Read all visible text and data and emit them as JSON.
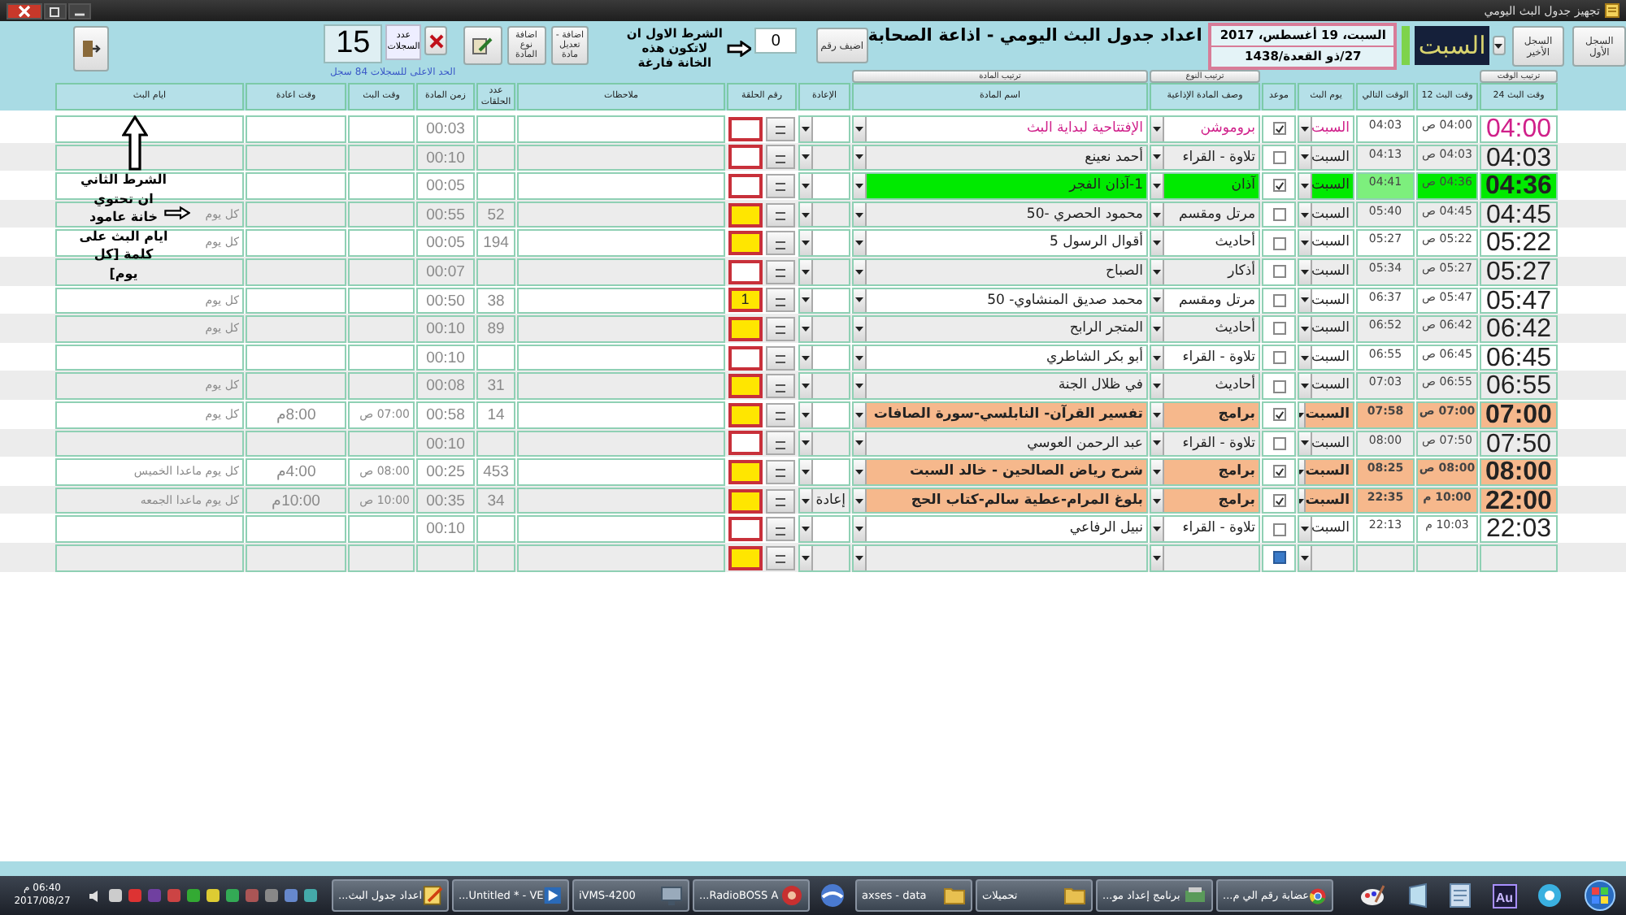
{
  "window": {
    "title": "تجهيز جدول البث اليومي"
  },
  "nav_buttons": [
    "السجل الأول",
    "السجل الأخير"
  ],
  "day_name": "السبت",
  "date": {
    "gregorian": "السبت، 19 أغسطس، 2017",
    "hijri": "27/ذو القعدة/1438"
  },
  "title": "اعداد جدول البث اليومي - اذاعة الصحابة",
  "add_number_button": "اضيف رقم",
  "number_field": {
    "value": "0"
  },
  "note_1": "الشرط الاول ان لاتكون هذه الخانة فارغة",
  "tool_buttons": [
    "اضافة - تعديل مادة",
    "اضافة نوع المادة"
  ],
  "record_count": {
    "label": "عدد السجلات",
    "value": "15",
    "limit": "الحد الاعلى للسجلات 84 سجل"
  },
  "sort_buttons": {
    "time": "ترتيب الوقت",
    "type": "ترتيب النوع",
    "name": "ترتيب المادة"
  },
  "table": {
    "columns": [
      "وقت البث 24",
      "وقت البث 12",
      "الوقت التالي",
      "يوم البث",
      "موعد",
      "وصف المادة الإذاعية",
      "اسم المادة",
      "الإعادة",
      "رقم الحلقة",
      "ملاحظات",
      "عدد الحلقات",
      "زمن المادة",
      "وقت البث",
      "وقت اعادة",
      "ايام البث"
    ],
    "rows": [
      {
        "t24": "04:00",
        "t12": "04:00 ص",
        "next": "04:03",
        "day": "السبت",
        "appointment": true,
        "type": "بروموشن",
        "name": "الإفتتاحية لبداية البث",
        "episode_filled": false,
        "duration": "00:03",
        "kind": "promo"
      },
      {
        "t24": "04:03",
        "t12": "04:03 ص",
        "next": "04:13",
        "day": "السبت",
        "appointment": false,
        "type": "تلاوة - القراء",
        "name": "أحمد نعينع",
        "episode_filled": false,
        "duration": "00:10",
        "kind": "plain"
      },
      {
        "t24": "04:36",
        "t12": "04:36 ص",
        "next": "04:41",
        "day": "السبت",
        "appointment": true,
        "type": "آذان",
        "name": "1-آذان الفجر",
        "episode_filled": false,
        "duration": "00:05",
        "kind": "adhan"
      },
      {
        "t24": "04:45",
        "t12": "04:45 ص",
        "next": "05:40",
        "day": "السبت",
        "appointment": false,
        "type": "مرتل ومقسم",
        "name": "محمود الحصري -50",
        "episode_filled": true,
        "count": "52",
        "duration": "00:55",
        "days": "كل يوم",
        "kind": "plain"
      },
      {
        "t24": "05:22",
        "t12": "05:22 ص",
        "next": "05:27",
        "day": "السبت",
        "appointment": false,
        "type": "أحاديث",
        "name": "أقوال الرسول 5",
        "episode_filled": true,
        "count": "194",
        "duration": "00:05",
        "days": "كل يوم",
        "kind": "plain"
      },
      {
        "t24": "05:27",
        "t12": "05:27 ص",
        "next": "05:34",
        "day": "السبت",
        "appointment": false,
        "type": "أذكار",
        "name": "الصباح",
        "episode_filled": false,
        "duration": "00:07",
        "kind": "plain"
      },
      {
        "t24": "05:47",
        "t12": "05:47 ص",
        "next": "06:37",
        "day": "السبت",
        "appointment": false,
        "type": "مرتل ومقسم",
        "name": "محمد صديق المنشاوي- 50",
        "episode": "1",
        "episode_filled": true,
        "count": "38",
        "duration": "00:50",
        "days": "كل يوم",
        "kind": "plain"
      },
      {
        "t24": "06:42",
        "t12": "06:42 ص",
        "next": "06:52",
        "day": "السبت",
        "appointment": false,
        "type": "أحاديث",
        "name": "المتجر الرابح",
        "episode_filled": true,
        "count": "89",
        "duration": "00:10",
        "days": "كل يوم",
        "kind": "plain"
      },
      {
        "t24": "06:45",
        "t12": "06:45 ص",
        "next": "06:55",
        "day": "السبت",
        "appointment": false,
        "type": "تلاوة - القراء",
        "name": "أبو بكر الشاطري",
        "episode_filled": false,
        "duration": "00:10",
        "kind": "plain"
      },
      {
        "t24": "06:55",
        "t12": "06:55 ص",
        "next": "07:03",
        "day": "السبت",
        "appointment": false,
        "type": "أحاديث",
        "name": "في ظلال الجنة",
        "episode_filled": true,
        "count": "31",
        "duration": "00:08",
        "days": "كل يوم",
        "kind": "plain"
      },
      {
        "t24": "07:00",
        "t12": "07:00 ص",
        "next": "07:58",
        "day": "السبت",
        "appointment": true,
        "type": "برامج",
        "name": "تفسير القرآن- النابلسي-سورة الصافات",
        "episode_filled": true,
        "count": "14",
        "duration": "00:58",
        "air_time": "07:00 ص",
        "rerun_time": "8:00م",
        "days": "كل يوم",
        "kind": "program"
      },
      {
        "t24": "07:50",
        "t12": "07:50 ص",
        "next": "08:00",
        "day": "السبت",
        "appointment": false,
        "type": "تلاوة - القراء",
        "name": "عبد الرحمن العوسي",
        "episode_filled": false,
        "duration": "00:10",
        "kind": "plain"
      },
      {
        "t24": "08:00",
        "t12": "08:00 ص",
        "next": "08:25",
        "day": "السبت",
        "appointment": true,
        "type": "برامج",
        "name": "شرح رياض الصالحين - خالد السبت",
        "episode_filled": true,
        "count": "453",
        "duration": "00:25",
        "air_time": "08:00 ص",
        "rerun_time": "4:00م",
        "days": "كل يوم ماعدا الخميس",
        "kind": "program"
      },
      {
        "t24": "22:00",
        "t12": "10:00 م",
        "next": "22:35",
        "day": "السبت",
        "appointment": true,
        "type": "برامج",
        "name": "بلوغ المرام-عطية سالم-كتاب الحج",
        "rerun": "إعادة",
        "episode_filled": true,
        "count": "34",
        "duration": "00:35",
        "air_time": "10:00 ص",
        "rerun_time": "10:00م",
        "days": "كل يوم ماعدا الجمعه",
        "kind": "program"
      },
      {
        "t24": "22:03",
        "t12": "10:03 م",
        "next": "22:13",
        "day": "السبت",
        "appointment": false,
        "type": "تلاوة - القراء",
        "name": "نبيل الرفاعي",
        "episode_filled": false,
        "duration": "00:10",
        "kind": "plain"
      },
      {
        "kind": "new",
        "appointment": false,
        "episode_filled": true
      }
    ]
  },
  "note_2": "الشرط الثاني ان تحتوي خانة عامود ايام البث على كلمة [كل يوم]",
  "taskbar": {
    "clock": {
      "time": "06:40 م",
      "date": "2017/08/27"
    },
    "tasks": [
      {
        "kind": "browser",
        "label": "عضابة رقم الي م..."
      },
      {
        "kind": "installer",
        "label": "برنامج إعداد مو..."
      },
      {
        "kind": "folder",
        "label": "تحميلات"
      },
      {
        "kind": "folder",
        "label": "axses - data"
      },
      {
        "kind": "sphere"
      },
      {
        "kind": "radio",
        "label": "RadioBOSS A..."
      },
      {
        "kind": "camera",
        "label": "iVMS-4200"
      },
      {
        "kind": "video",
        "label": "Untitled * - VE..."
      },
      {
        "kind": "editor",
        "label": "اعداد جدول البث..."
      }
    ],
    "pinned_label": "Au"
  }
}
